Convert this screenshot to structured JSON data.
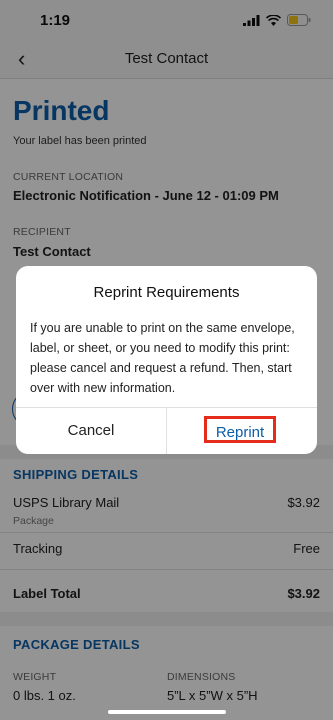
{
  "status": {
    "time": "1:19"
  },
  "nav": {
    "title": "Test Contact"
  },
  "header": {
    "status_title": "Printed",
    "status_sub": "Your label has been printed"
  },
  "location": {
    "label": "CURRENT LOCATION",
    "value": "Electronic Notification - June 12 - 01:09 PM"
  },
  "recipient": {
    "label": "RECIPIENT",
    "name": "Test Contact"
  },
  "shipping": {
    "heading": "SHIPPING DETAILS",
    "service": "USPS Library Mail",
    "service_price": "$3.92",
    "service_sub": "Package",
    "tracking_label": "Tracking",
    "tracking_value": "Free",
    "total_label": "Label Total",
    "total_value": "$3.92"
  },
  "package": {
    "heading": "PACKAGE DETAILS",
    "weight_label": "WEIGHT",
    "weight_value": "0 lbs. 1 oz.",
    "dims_label": "DIMENSIONS",
    "dims_value": "5”L x 5”W x 5”H"
  },
  "dialog": {
    "title": "Reprint Requirements",
    "message": "If you are unable to print on the same envelope, label, or sheet, or you need to modify this print: please cancel and request a refund. Then, start over with new information.",
    "cancel": "Cancel",
    "confirm": "Reprint"
  },
  "colors": {
    "accent": "#0b5ea8",
    "highlight": "#e52b1a"
  }
}
